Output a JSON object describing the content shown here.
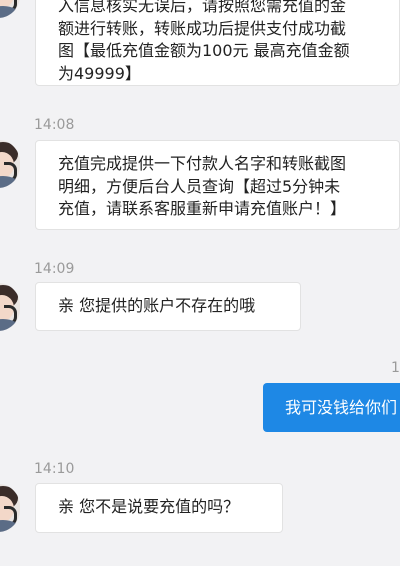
{
  "messages": [
    {
      "text": "入信息核实无误后，请按照您需充值的金\n额进行转账，转账成功后提供支付成功截\n图【最低充值金额为100元 最高充值金额\n为49999】"
    },
    {
      "time": "14:08",
      "text": "充值完成提供一下付款人名字和转账截图\n明细，方便后台人员查询【超过5分钟未\n充值，请联系客服重新申请充值账户！】"
    },
    {
      "time": "14:09",
      "text": "亲 您提供的账户不存在的哦"
    },
    {
      "time": "1",
      "text": "我可没钱给你们"
    },
    {
      "time": "14:10",
      "text": "亲 您不是说要充值的吗？"
    }
  ]
}
